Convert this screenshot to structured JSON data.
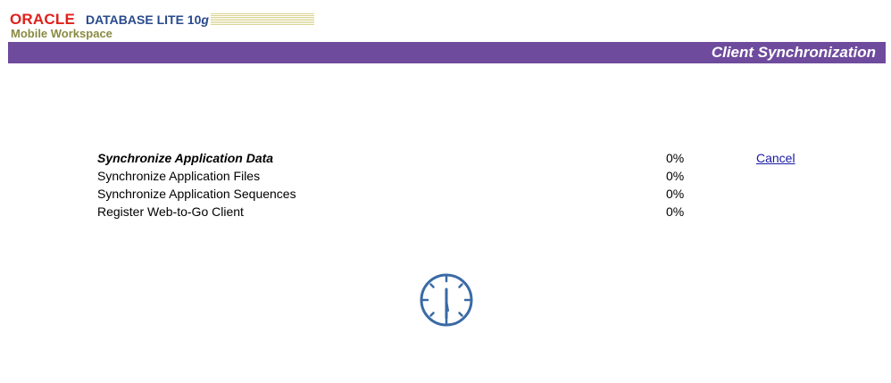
{
  "header": {
    "brand": "ORACLE",
    "product": "DATABASE LITE 10",
    "product_version": "g",
    "subtitle": "Mobile Workspace"
  },
  "title_bar": {
    "title": "Client Synchronization"
  },
  "tasks": [
    {
      "label": "Synchronize Application Data",
      "percent": "0%",
      "active": true
    },
    {
      "label": "Synchronize Application Files",
      "percent": "0%",
      "active": false
    },
    {
      "label": "Synchronize Application Sequences",
      "percent": "0%",
      "active": false
    },
    {
      "label": "Register Web-to-Go Client",
      "percent": "0%",
      "active": false
    }
  ],
  "actions": {
    "cancel_label": "Cancel"
  },
  "icons": {
    "progress": "clock-icon"
  },
  "colors": {
    "brand_red": "#e0201b",
    "product_blue": "#2a4a8c",
    "subtitle_olive": "#8a8a43",
    "title_bar": "#6e4b9c",
    "link": "#1a1aa6",
    "clock": "#3a6aa6"
  }
}
